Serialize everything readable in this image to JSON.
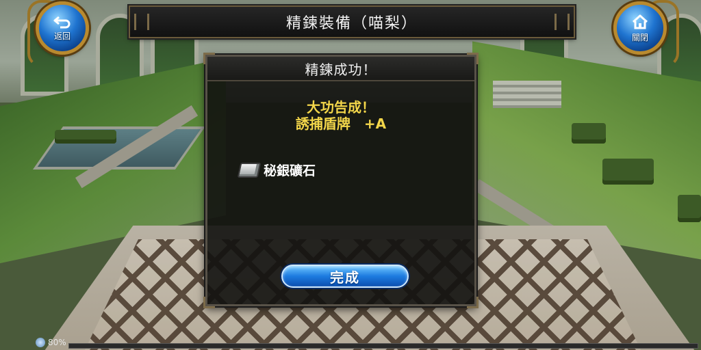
{
  "header": {
    "title": "精鍊裝備（喵梨）"
  },
  "back_button": {
    "label": "返回",
    "icon": "return-arrow-icon"
  },
  "close_button": {
    "label": "關閉",
    "icon": "home-icon"
  },
  "dialog": {
    "title": "精鍊成功！",
    "message_line1": "大功告成！",
    "message_line2": "誘捕盾牌　+A",
    "material_name": "秘銀礦石",
    "material_icon": "ore-icon",
    "done_label": "完成"
  },
  "status": {
    "battery_text": "80%",
    "xp_progress": 0.0
  },
  "colors": {
    "accent_yellow": "#f3d64a",
    "button_blue": "#1d7be0",
    "frame_gold": "#b98a2f"
  }
}
